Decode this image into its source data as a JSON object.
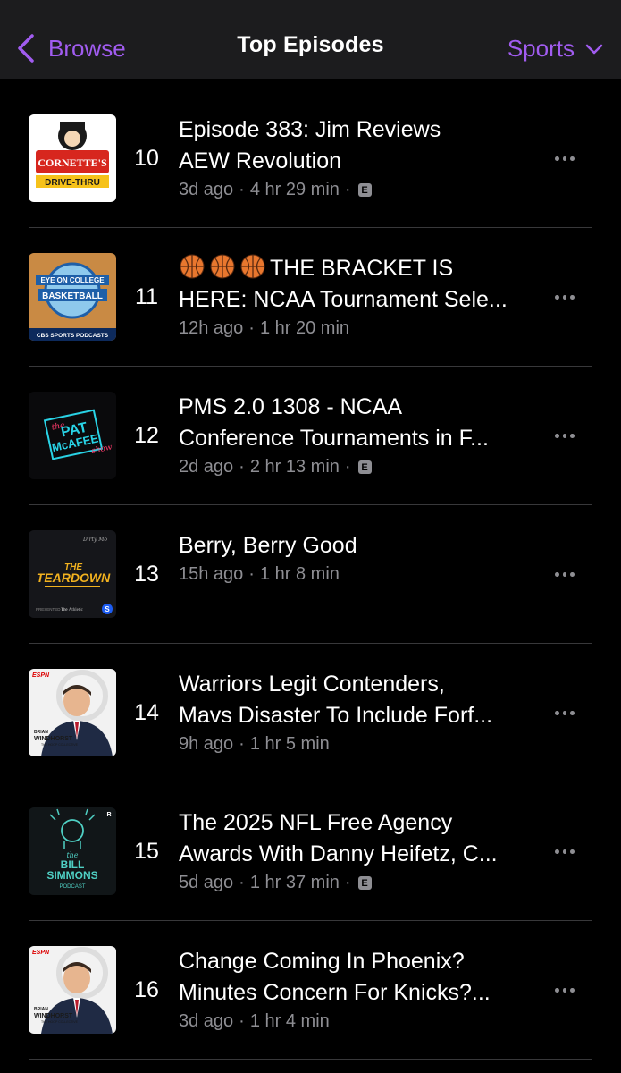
{
  "navbar": {
    "back_label": "Browse",
    "title": "Top Episodes",
    "category_label": "Sports"
  },
  "episodes": [
    {
      "rank": "10",
      "title_lines": [
        "Episode 383: Jim Reviews",
        "AEW Revolution"
      ],
      "age": "3d ago",
      "duration": "4 hr 29 min",
      "explicit": true,
      "artwork": "cornette-drive-thru-art",
      "art_text": [
        "CORNETTE'S",
        "DRIVE-THRU"
      ]
    },
    {
      "rank": "11",
      "title_lines": [
        "🏀🏀🏀THE BRACKET IS",
        "HERE: NCAA Tournament Sele..."
      ],
      "age": "12h ago",
      "duration": "1 hr 20 min",
      "explicit": false,
      "artwork": "eye-on-college-basketball-art",
      "art_text": [
        "EYE ON",
        "COLLEGE",
        "BASKETBALL",
        "CBS SPORTS PODCASTS"
      ]
    },
    {
      "rank": "12",
      "title_lines": [
        "PMS 2.0 1308 - NCAA",
        "Conference Tournaments in F..."
      ],
      "age": "2d ago",
      "duration": "2 hr 13 min",
      "explicit": true,
      "artwork": "pat-mcafee-show-art",
      "art_text": [
        "the",
        "PAT",
        "McAFEE",
        "show"
      ]
    },
    {
      "rank": "13",
      "title_lines": [
        "Berry, Berry Good"
      ],
      "age": "15h ago",
      "duration": "1 hr 8 min",
      "explicit": false,
      "artwork": "the-teardown-art",
      "art_text": [
        "THE",
        "TEARDOWN",
        "Dirty Mo",
        "PRESENTED BY",
        "The Athletic"
      ]
    },
    {
      "rank": "14",
      "title_lines": [
        "Warriors Legit Contenders,",
        "Mavs Disaster To Include Forf..."
      ],
      "age": "9h ago",
      "duration": "1 hr 5 min",
      "explicit": false,
      "artwork": "brian-windhorst-art",
      "art_text": [
        "ESPN",
        "BRIAN",
        "WINDHORST",
        "THE HOOP COLLECTIVE"
      ]
    },
    {
      "rank": "15",
      "title_lines": [
        "The 2025 NFL Free Agency",
        "Awards With Danny Heifetz, C..."
      ],
      "age": "5d ago",
      "duration": "1 hr 37 min",
      "explicit": true,
      "artwork": "bill-simmons-podcast-art",
      "art_text": [
        "the",
        "BILL",
        "SIMMONS",
        "PODCAST"
      ]
    },
    {
      "rank": "16",
      "title_lines": [
        "Change Coming In Phoenix?",
        "Minutes Concern For Knicks?..."
      ],
      "age": "3d ago",
      "duration": "1 hr 4 min",
      "explicit": false,
      "artwork": "brian-windhorst-art",
      "art_text": [
        "ESPN",
        "BRIAN",
        "WINDHORST",
        "THE HOOP COLLECTIVE"
      ]
    }
  ],
  "meta_separator": "·",
  "explicit_badge": "E",
  "colors": {
    "accent": "#a15cf0",
    "background": "#000000",
    "navbar": "#1c1c1e",
    "secondary_text": "#8e8e93",
    "separator": "#38383a"
  }
}
